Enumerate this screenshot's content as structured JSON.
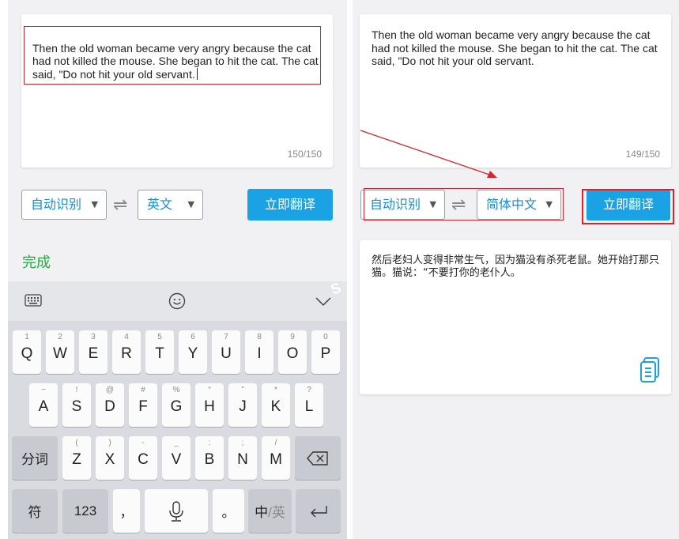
{
  "left": {
    "source_text": "Then the old woman became very angry because the cat\nhad not killed the mouse. She began to hit the cat. The cat\nsaid, \"Do not hit your old servant.",
    "counter": "150/150",
    "source_lang": "自动识别",
    "target_lang": "英文",
    "translate_label": "立即翻译",
    "done_label": "完成"
  },
  "right": {
    "source_text": "Then the old woman became very angry because the cat\nhad not killed the mouse. She began to hit the cat. The cat\nsaid, \"Do not hit your old servant.",
    "counter": "149/150",
    "source_lang": "自动识别",
    "target_lang": "简体中文",
    "translate_label": "立即翻译",
    "result_text": "然后老妇人变得非常生气，因为猫没有杀死老鼠。她开始打那只猫。猫说：“不要打你的老仆人。"
  },
  "keyboard": {
    "row1": [
      {
        "main": "Q",
        "hint": "1"
      },
      {
        "main": "W",
        "hint": "2"
      },
      {
        "main": "E",
        "hint": "3"
      },
      {
        "main": "R",
        "hint": "4"
      },
      {
        "main": "T",
        "hint": "5"
      },
      {
        "main": "Y",
        "hint": "6"
      },
      {
        "main": "U",
        "hint": "7"
      },
      {
        "main": "I",
        "hint": "8"
      },
      {
        "main": "O",
        "hint": "9"
      },
      {
        "main": "P",
        "hint": "0"
      }
    ],
    "row2": [
      {
        "main": "A",
        "hint": "~"
      },
      {
        "main": "S",
        "hint": "!"
      },
      {
        "main": "D",
        "hint": "@"
      },
      {
        "main": "F",
        "hint": "#"
      },
      {
        "main": "G",
        "hint": "%"
      },
      {
        "main": "H",
        "hint": "“"
      },
      {
        "main": "J",
        "hint": "”"
      },
      {
        "main": "K",
        "hint": "*"
      },
      {
        "main": "L",
        "hint": "?"
      }
    ],
    "row3": [
      {
        "main": "Z",
        "hint": "("
      },
      {
        "main": "X",
        "hint": ")"
      },
      {
        "main": "C",
        "hint": "-"
      },
      {
        "main": "V",
        "hint": "_"
      },
      {
        "main": "B",
        "hint": ":"
      },
      {
        "main": "N",
        "hint": ";"
      },
      {
        "main": "M",
        "hint": "/"
      }
    ],
    "fenci_label": "分词",
    "symbol_label": "符",
    "numbers_label": "123",
    "comma_label": "，",
    "period_label": "。",
    "lang_switch_primary": "中",
    "lang_switch_secondary": "/英"
  },
  "icons": {
    "keyboard": "keyboard-icon",
    "emoji": "emoji-icon",
    "collapse": "chevron-down-icon",
    "swap": "swap-icon",
    "copy": "copy-icon",
    "mic": "microphone-icon",
    "backspace": "backspace-icon",
    "enter": "enter-icon"
  },
  "colors": {
    "accent_blue": "#1ba2e4",
    "done_green": "#29a944",
    "highlight_red": "#d9232e"
  }
}
